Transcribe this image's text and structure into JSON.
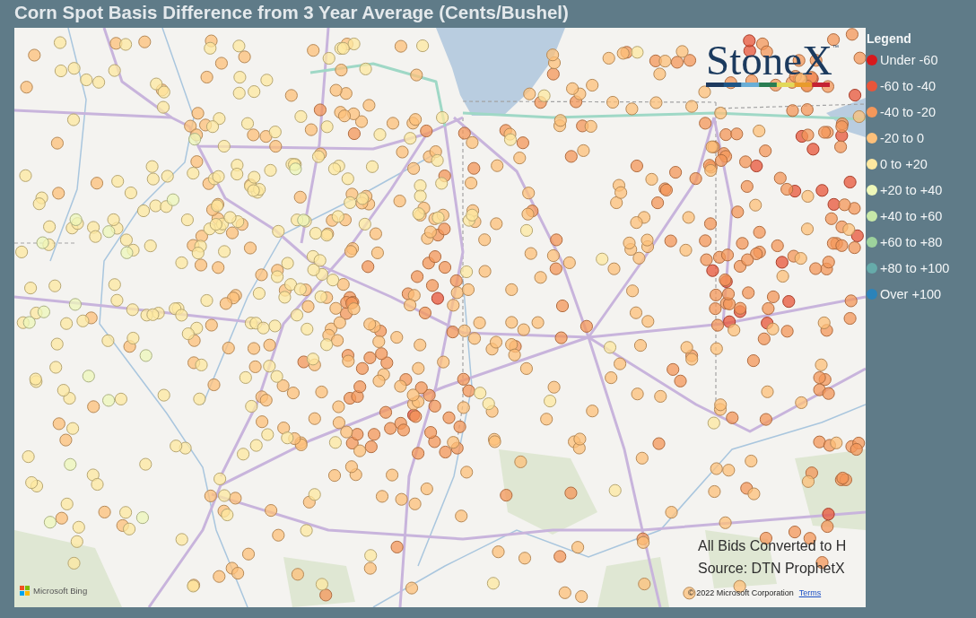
{
  "title": "Corn Spot Basis Difference from 3 Year Average (Cents/Bushel)",
  "map": {
    "logo": {
      "wordmark": "StoneX",
      "trademark": "™"
    },
    "notes": [
      "All Bids Converted to H",
      "Source: DTN ProphetX"
    ],
    "attribution": {
      "provider": "Microsoft Bing",
      "copyright": "© 2022 Microsoft Corporation",
      "terms_link": "Terms"
    }
  },
  "legend": {
    "title": "Legend",
    "items": [
      {
        "label": "Under -60",
        "color": "#d7191c"
      },
      {
        "label": "-60 to -40",
        "color": "#e8553a"
      },
      {
        "label": "-40 to -20",
        "color": "#f4975a"
      },
      {
        "label": "-20 to 0",
        "color": "#fdc07a"
      },
      {
        "label": "0 to +20",
        "color": "#fee8a0"
      },
      {
        "label": "+20 to +40",
        "color": "#eef7b9"
      },
      {
        "label": "+40 to +60",
        "color": "#c7e8a8"
      },
      {
        "label": "+60 to +80",
        "color": "#9dd29c"
      },
      {
        "label": "+80 to +100",
        "color": "#66abaa"
      },
      {
        "label": "Over +100",
        "color": "#2b83ba"
      }
    ]
  }
}
